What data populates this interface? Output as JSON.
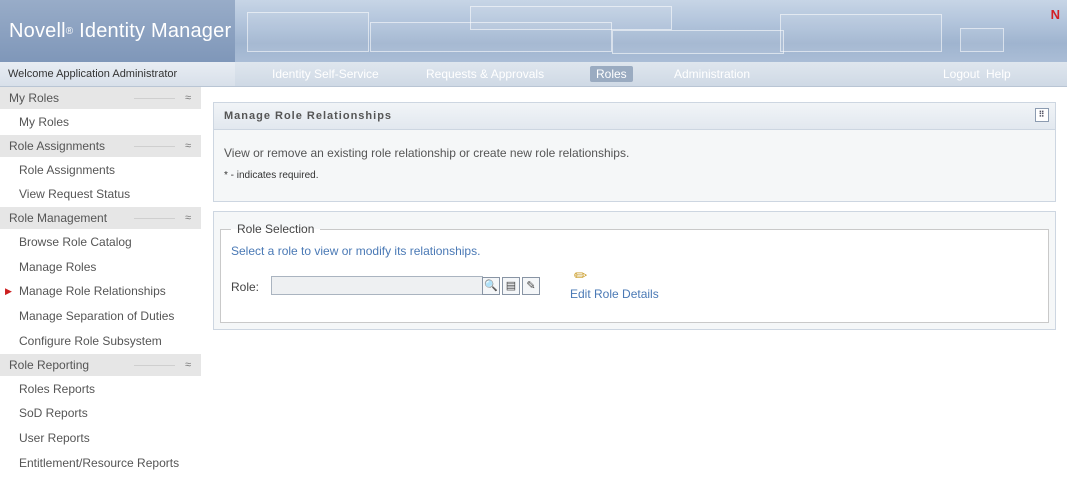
{
  "header": {
    "product_name": "Novell",
    "registered_mark": "®",
    "product_suffix": "Identity Manager",
    "brand_mark": "N"
  },
  "nav": {
    "welcome": "Welcome Application Administrator",
    "items": [
      {
        "label": "Identity Self-Service",
        "active": false
      },
      {
        "label": "Requests & Approvals",
        "active": false
      },
      {
        "label": "Roles",
        "active": true
      },
      {
        "label": "Administration",
        "active": false
      }
    ],
    "logout": "Logout",
    "help": "Help"
  },
  "sidebar": {
    "collapse_glyph": "≈",
    "sections": [
      {
        "title": "My Roles",
        "items": [
          "My Roles"
        ]
      },
      {
        "title": "Role Assignments",
        "items": [
          "Role Assignments",
          "View Request Status"
        ]
      },
      {
        "title": "Role Management",
        "items": [
          "Browse Role Catalog",
          "Manage Roles",
          "Manage Role Relationships",
          "Manage Separation of Duties",
          "Configure Role Subsystem"
        ]
      },
      {
        "title": "Role Reporting",
        "items": [
          "Roles Reports",
          "SoD Reports",
          "User Reports",
          "Entitlement/Resource Reports"
        ]
      }
    ],
    "selected_item": "Manage Role Relationships"
  },
  "main": {
    "title": "Manage Role Relationships",
    "description": "View or remove an existing role relationship or create new role relationships.",
    "required_note": "* - indicates required.",
    "role_selection": {
      "legend": "Role Selection",
      "instruction": "Select a role to view or modify its relationships.",
      "role_label": "Role:",
      "role_value": "",
      "edit_details": "Edit Role Details"
    }
  },
  "colors": {
    "accent_link": "#4a79b5",
    "active_nav": "#9aabc1",
    "brand_red": "#d21f25"
  }
}
